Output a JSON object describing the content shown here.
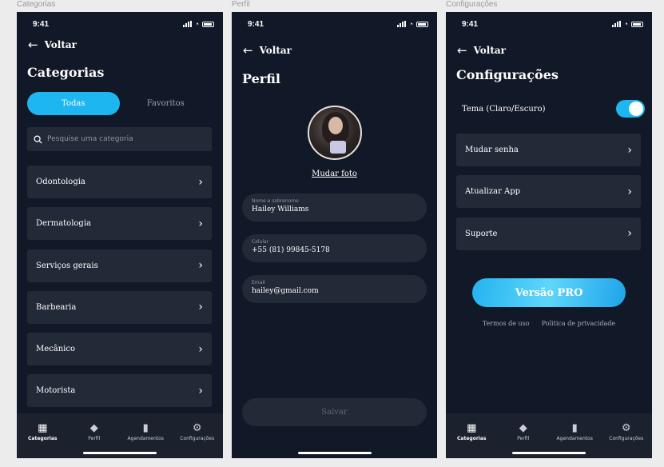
{
  "frames": [
    "Categorias",
    "Perfil",
    "Configurações"
  ],
  "status": {
    "time": "9:41"
  },
  "back_label": "Voltar",
  "categories_screen": {
    "title": "Categorias",
    "segments": [
      {
        "label": "Todas",
        "active": true
      },
      {
        "label": "Favoritos",
        "active": false
      }
    ],
    "search_placeholder": "Pesquise uma categoria",
    "items": [
      "Odontologia",
      "Dermatologia",
      "Serviços gerais",
      "Barbearia",
      "Mecânico",
      "Motorista"
    ]
  },
  "profile_screen": {
    "title": "Perfil",
    "change_photo": "Mudar foto",
    "fields": [
      {
        "label": "Nome e sobrenome",
        "value": "Hailey Williams"
      },
      {
        "label": "Celular",
        "value": "+55 (81) 99845-5178"
      },
      {
        "label": "Email",
        "value": "hailey@gmail.com"
      }
    ],
    "save_label": "Salvar"
  },
  "settings_screen": {
    "title": "Configurações",
    "theme_label": "Tema (Claro/Escuro)",
    "theme_on": true,
    "items": [
      "Mudar senha",
      "Atualizar App",
      "Suporte"
    ],
    "pro_label": "Versão PRO",
    "links": [
      "Termos de uso",
      "Politica de privacidade"
    ]
  },
  "tabbar": [
    {
      "label": "Categorias",
      "icon": "grid-icon"
    },
    {
      "label": "Perfil",
      "icon": "shield-icon"
    },
    {
      "label": "Agendamentos",
      "icon": "bookmark-icon"
    },
    {
      "label": "Configurações",
      "icon": "gear-icon"
    }
  ],
  "colors": {
    "background": "#111827",
    "card": "#222937",
    "accent": "#1eb6f0"
  }
}
